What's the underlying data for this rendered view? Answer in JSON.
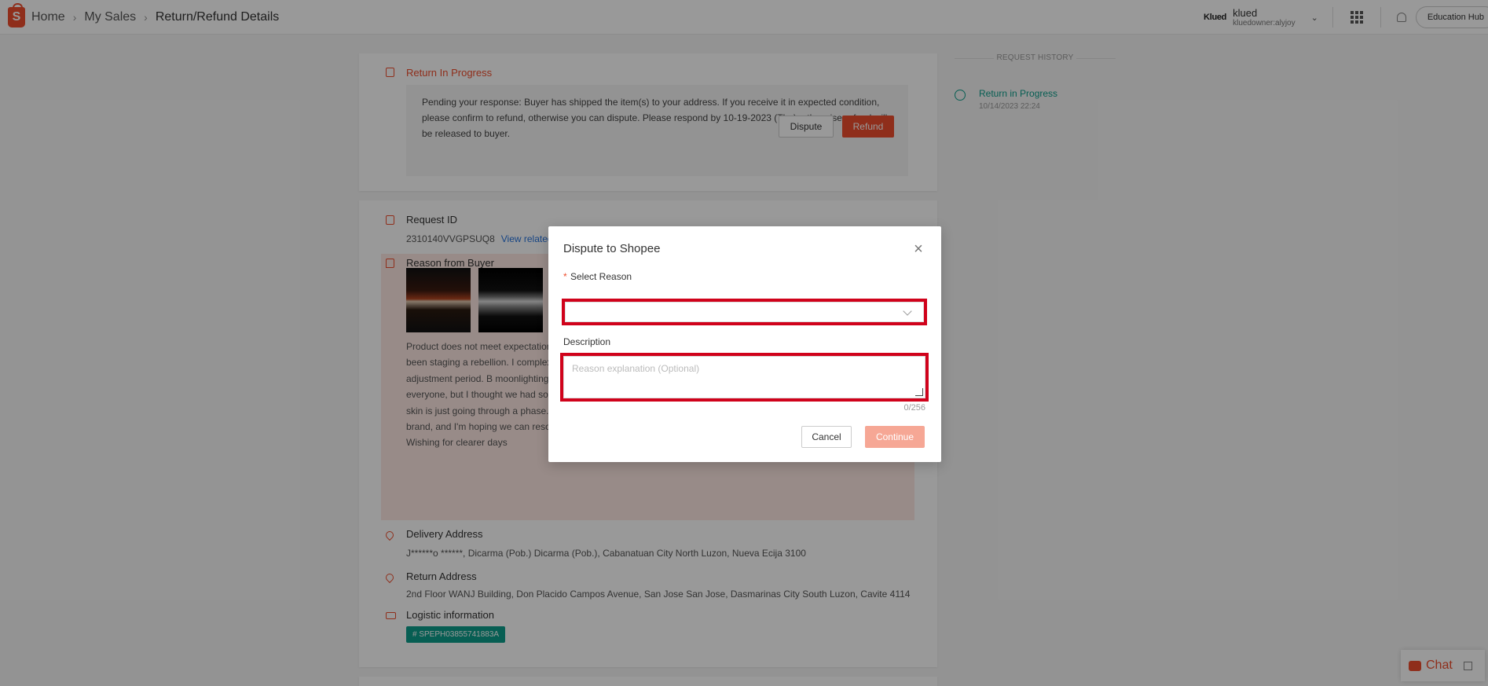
{
  "header": {
    "logo_letter": "S",
    "breadcrumbs": [
      "Home",
      "My Sales",
      "Return/Refund Details"
    ],
    "brand": "Klued",
    "user_name": "klued",
    "user_sub": "kluedowner:alyjoy",
    "education_hub": "Education Hub"
  },
  "status": {
    "title": "Return In Progress",
    "notice": "Pending your response: Buyer has shipped the item(s) to your address. If you receive it in expected condition, please confirm to refund, otherwise you can dispute. Please respond by 10-19-2023 (Thu), otherwise refund will be released to buyer.",
    "dispute_label": "Dispute",
    "refund_label": "Refund"
  },
  "request": {
    "title": "Request ID",
    "id": "2310140VVGPSUQ8",
    "view_related": "View related",
    "reason_title": "Reason from Buyer",
    "reason_text": "Product does not meet expectation Subject: Feeling a bit betrayed by my your salicylic acid cleanser, and it's skin has been staging a rebellion. I complexion. However, my skin seems left with a complexion that feels str skin needs an adjustment period. B moonlighting as a villain in this skincare soap. I understand that not every product is a match for everyone, but I thought we had something special. Perhaps there's a secret ingredient causing the discord, or maybe my skin is just going through a phase. Either way, I felt it was important to share my experience. I still have faith in your brand, and I'm hoping we can resolve this skincare soap opera. Any advice or insights would be greatly appreciated. Wishing for clearer days",
    "delivery_title": "Delivery Address",
    "delivery_text": "J******o ******, Dicarma (Pob.) Dicarma (Pob.), Cabanatuan City North Luzon, Nueva Ecija 3100",
    "return_title": "Return Address",
    "return_text": "2nd Floor WANJ Building, Don Placido Campos Avenue, San Jose San Jose, Dasmarinas City South Luzon, Cavite 4114",
    "logistic_title": "Logistic information",
    "tracking": "# SPEPH03855741883A"
  },
  "history": {
    "header": "REQUEST HISTORY",
    "item_title": "Return in Progress",
    "item_time": "10/14/2023 22:24"
  },
  "chat": {
    "label": "Chat"
  },
  "modal": {
    "title": "Dispute to Shopee",
    "required_mark": "*",
    "select_label": "Select Reason",
    "select_value": "",
    "description_label": "Description",
    "description_placeholder": "Reason explanation (Optional)",
    "counter": "0/256",
    "cancel_label": "Cancel",
    "continue_label": "Continue"
  },
  "colors": {
    "brand": "#ee4d2d",
    "teal": "#0c9d8a",
    "highlight_border": "#d0021b",
    "continue_disabled": "#f6a795"
  }
}
